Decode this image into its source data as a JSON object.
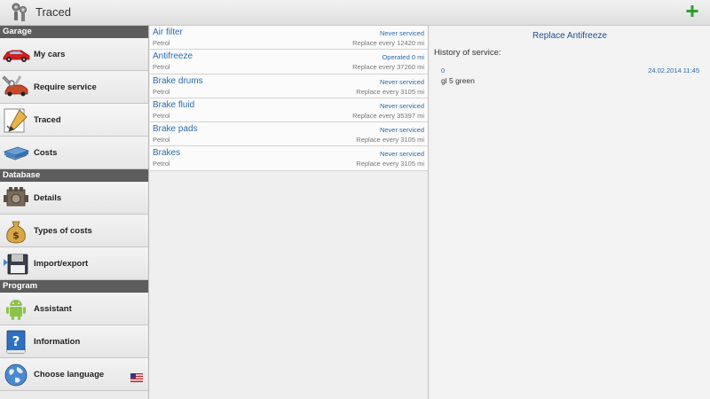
{
  "app": {
    "title": "Traced"
  },
  "sidebar": {
    "sections": [
      {
        "header": "Garage",
        "items": [
          {
            "label": "My cars",
            "icon": "car-icon"
          },
          {
            "label": "Require service",
            "icon": "repair-car-icon"
          },
          {
            "label": "Traced",
            "icon": "pen-document-icon"
          },
          {
            "label": "Costs",
            "icon": "money-stack-icon"
          }
        ]
      },
      {
        "header": "Database",
        "items": [
          {
            "label": "Details",
            "icon": "engine-icon"
          },
          {
            "label": "Types of costs",
            "icon": "money-bag-icon"
          },
          {
            "label": "Import/export",
            "icon": "floppy-disk-icon"
          }
        ]
      },
      {
        "header": "Program",
        "items": [
          {
            "label": "Assistant",
            "icon": "android-icon"
          },
          {
            "label": "Information",
            "icon": "help-book-icon"
          },
          {
            "label": "Choose language",
            "icon": "globe-icon",
            "flag": "us-flag-icon"
          }
        ]
      }
    ]
  },
  "list": {
    "rows": [
      {
        "name": "Air filter",
        "status": "Never serviced",
        "fuel": "Petrol",
        "interval": "Replace every 12420 mi"
      },
      {
        "name": "Antifreeze",
        "status": "Operated 0 mi",
        "fuel": "Petrol",
        "interval": "Replace every 37260 mi"
      },
      {
        "name": "Brake drums",
        "status": "Never serviced",
        "fuel": "Petrol",
        "interval": "Replace every 3105 mi"
      },
      {
        "name": "Brake fluid",
        "status": "Never serviced",
        "fuel": "Petrol",
        "interval": "Replace every 35397 mi"
      },
      {
        "name": "Brake pads",
        "status": "Never serviced",
        "fuel": "Petrol",
        "interval": "Replace every 3105 mi"
      },
      {
        "name": "Brakes",
        "status": "Never serviced",
        "fuel": "Petrol",
        "interval": "Replace every 3105 mi"
      }
    ]
  },
  "detail": {
    "title": "Replace Antifreeze",
    "history_label": "History of service:",
    "entries": [
      {
        "value": "0",
        "date": "24.02.2014 11:45",
        "comment": "gl 5 green"
      }
    ]
  },
  "colors": {
    "accent": "#2a6cb0",
    "add": "#2f9e2f",
    "section_header": "#5d5d5d",
    "title": "#1f4d8c"
  }
}
